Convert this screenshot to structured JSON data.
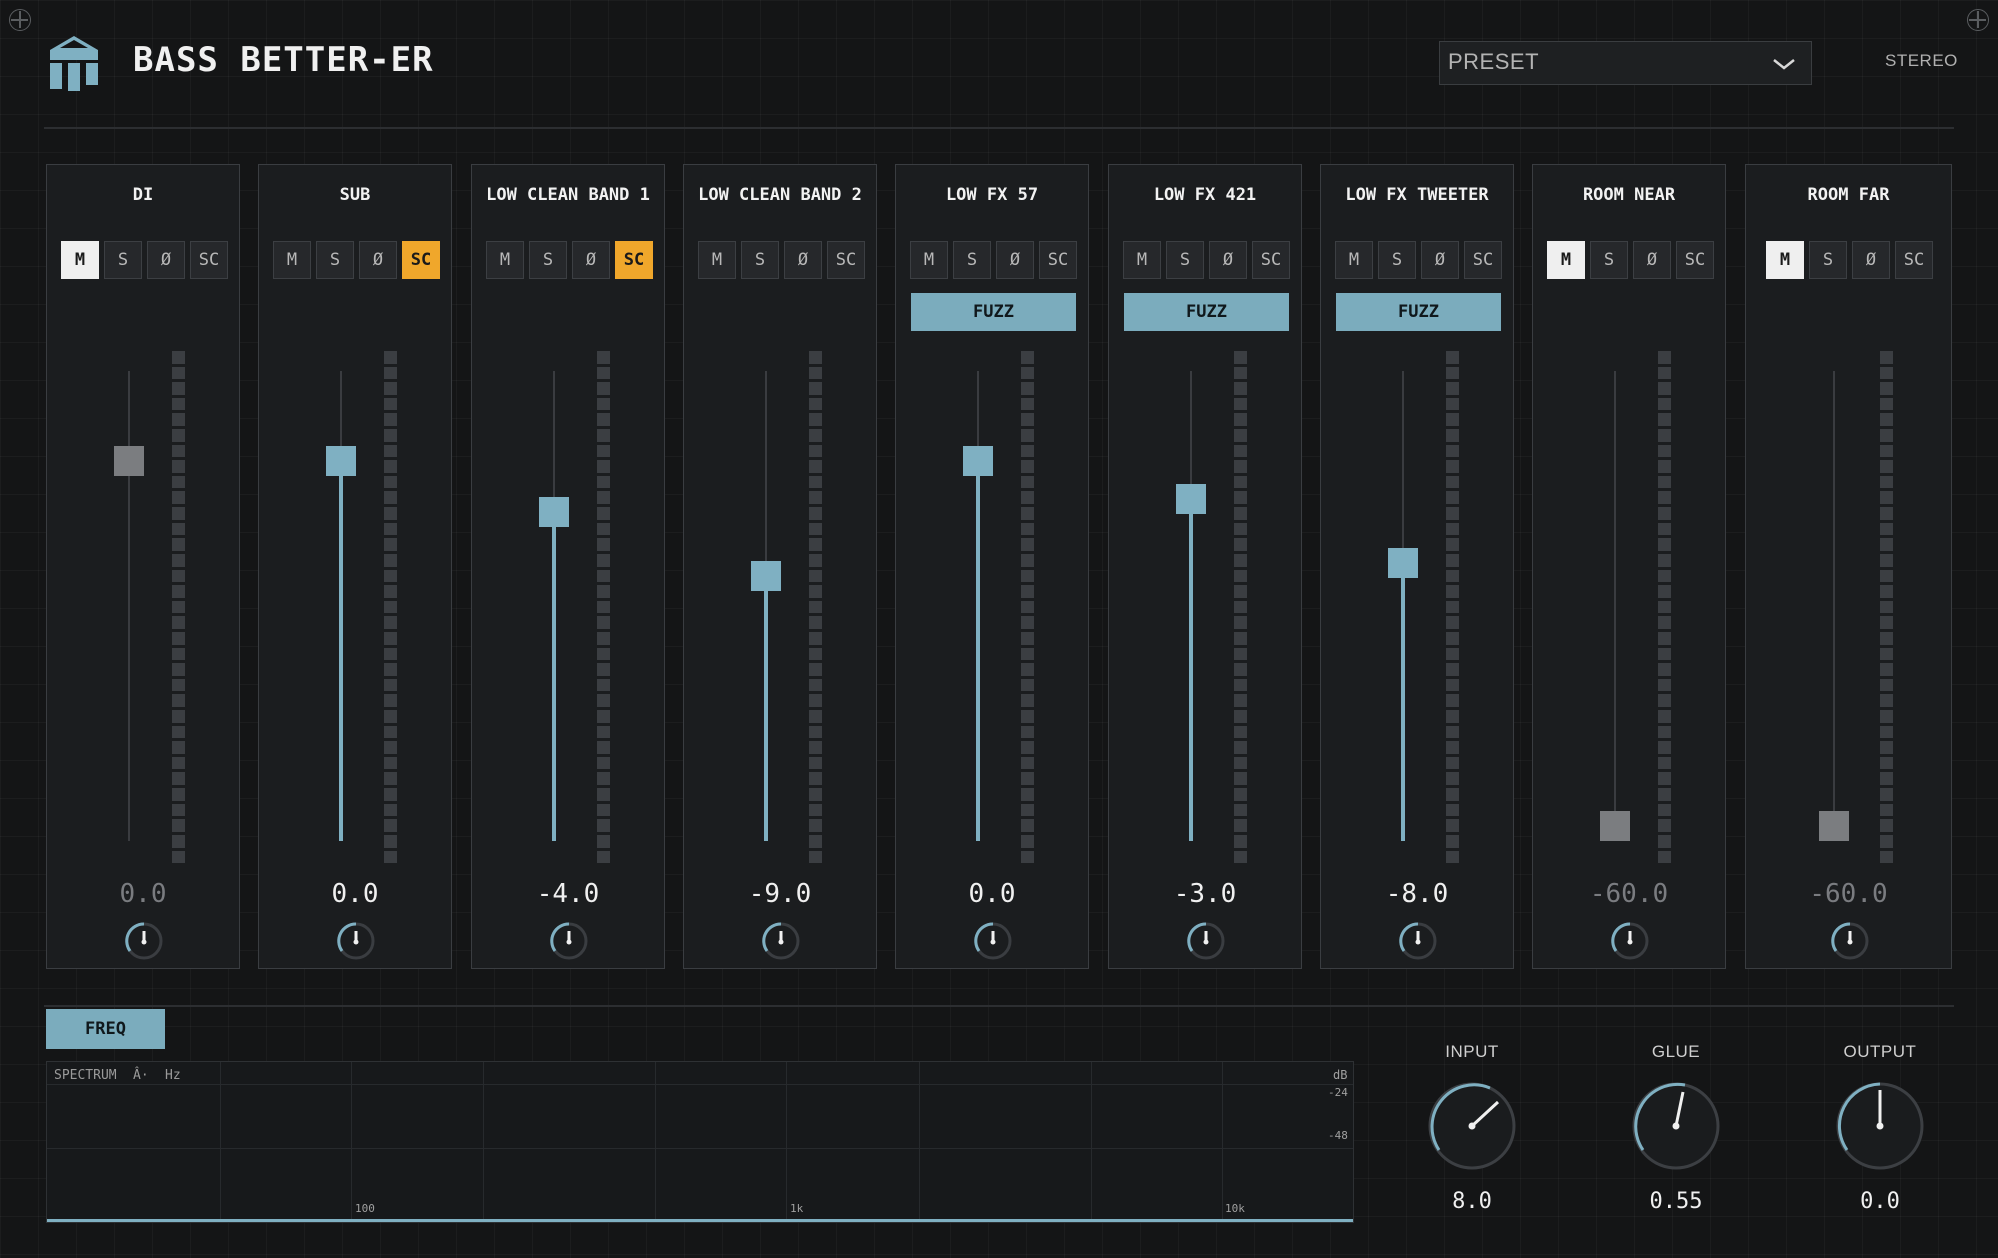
{
  "header": {
    "title": "BASS BETTER-ER",
    "preset_label": "PRESET",
    "mode_label": "STEREO"
  },
  "button_labels": {
    "mute": "M",
    "solo": "S",
    "phase": "Ø",
    "sidechain": "SC"
  },
  "colors": {
    "accent": "#7fb0c2",
    "sidechain_active": "#f0a72b",
    "mute_active": "#efefef",
    "panel": "#1b1d1f",
    "background": "#141516"
  },
  "channels": [
    {
      "name": "DI",
      "mute": true,
      "solo": false,
      "phase": false,
      "sidechain": false,
      "fx": "",
      "gain_db": "0.0",
      "active": false
    },
    {
      "name": "SUB",
      "mute": false,
      "solo": false,
      "phase": false,
      "sidechain": true,
      "fx": "",
      "gain_db": "0.0",
      "active": true
    },
    {
      "name": "LOW CLEAN BAND 1",
      "mute": false,
      "solo": false,
      "phase": false,
      "sidechain": true,
      "fx": "",
      "gain_db": "-4.0",
      "active": true
    },
    {
      "name": "LOW CLEAN BAND 2",
      "mute": false,
      "solo": false,
      "phase": false,
      "sidechain": false,
      "fx": "",
      "gain_db": "-9.0",
      "active": true
    },
    {
      "name": "LOW FX 57",
      "mute": false,
      "solo": false,
      "phase": false,
      "sidechain": false,
      "fx": "FUZZ",
      "gain_db": "0.0",
      "active": true
    },
    {
      "name": "LOW FX 421",
      "mute": false,
      "solo": false,
      "phase": false,
      "sidechain": false,
      "fx": "FUZZ",
      "gain_db": "-3.0",
      "active": true
    },
    {
      "name": "LOW FX TWEETER",
      "mute": false,
      "solo": false,
      "phase": false,
      "sidechain": false,
      "fx": "FUZZ",
      "gain_db": "-8.0",
      "active": true
    },
    {
      "name": "ROOM NEAR",
      "mute": true,
      "solo": false,
      "phase": false,
      "sidechain": false,
      "fx": "",
      "gain_db": "-60.0",
      "active": false
    },
    {
      "name": "ROOM FAR",
      "mute": true,
      "solo": false,
      "phase": false,
      "sidechain": false,
      "fx": "",
      "gain_db": "-60.0",
      "active": false
    }
  ],
  "freq_tab": "FREQ",
  "spectrum": {
    "label": "SPECTRUM",
    "weighting": "Â·",
    "unit_hz": "Hz",
    "unit_db": "dB",
    "db_ticks": [
      "-24",
      "-48"
    ],
    "freq_ticks": [
      "100",
      "1k",
      "10k"
    ]
  },
  "macros": {
    "input": {
      "label": "INPUT",
      "value": "8.0"
    },
    "glue": {
      "label": "GLUE",
      "value": "0.55"
    },
    "output": {
      "label": "OUTPUT",
      "value": "0.0"
    }
  }
}
